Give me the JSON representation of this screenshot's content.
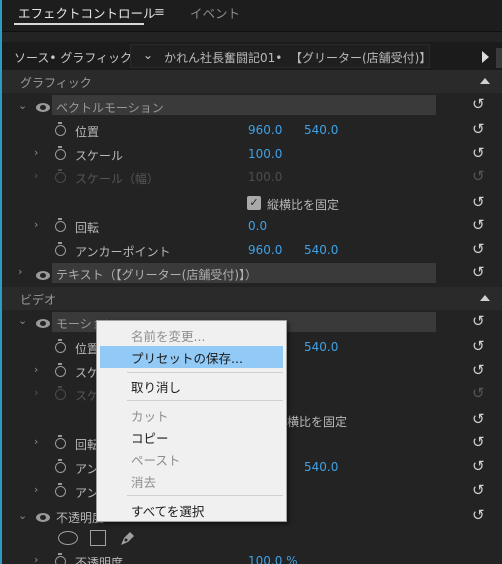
{
  "tabs": {
    "active": "エフェクトコントロール",
    "menu_icon": "≡",
    "inactive": "イベント"
  },
  "source": {
    "label": "ソース• グラフィック",
    "chevron": "⌄",
    "clip": "かれん社長奮闘記01•",
    "layer": "【グリーター(店舗受付)】"
  },
  "sections": {
    "graphic": "グラフィック",
    "vector_motion": "ベクトルモーション",
    "position": "位置",
    "pos_x": "960.0",
    "pos_y": "540.0",
    "scale": "スケール",
    "scale_val": "100.0",
    "scale_w": "スケール（幅）",
    "scale_w_val": "100.0",
    "uniform": "縦横比を固定",
    "rotation": "回転",
    "rot_val": "0.0",
    "anchor": "アンカーポイント",
    "anchor_x": "960.0",
    "anchor_y": "540.0",
    "text_layer": "テキスト（【グリーター(店舗受付)】）",
    "video": "ビデオ",
    "motion": "モーション",
    "v_pos": "位置",
    "v_pos_y": "540.0",
    "v_scale": "スケ",
    "v_scale_w": "スケ",
    "v_uniform": "横比を固定",
    "v_rot": "回転",
    "v_anchor": "アン",
    "v_anchor_y": "540.0",
    "v_anchor2": "アン",
    "opacity": "不透明度",
    "opacity2": "不透明度",
    "opacity_val": "100.0 %"
  },
  "context_menu": {
    "rename": "名前を変更...",
    "save_preset": "プリセットの保存...",
    "undo": "取り消し",
    "cut": "カット",
    "copy": "コピー",
    "paste": "ペースト",
    "delete": "消去",
    "select_all": "すべてを選択"
  },
  "icons": {
    "reset": "reset-icon",
    "eye": "eye-icon",
    "stopwatch": "stopwatch-icon"
  },
  "colors": {
    "accent": "#3fa2e6",
    "highlight": "#91c9f7",
    "bg": "#232323"
  }
}
